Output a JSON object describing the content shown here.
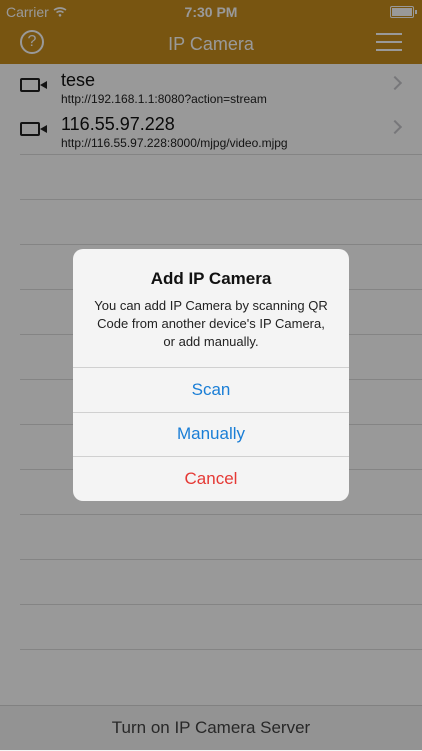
{
  "status_bar": {
    "carrier": "Carrier",
    "time": "7:30 PM"
  },
  "nav": {
    "help_label": "?",
    "title": "IP Camera"
  },
  "cameras": [
    {
      "name": "tese",
      "url": "http://192.168.1.1:8080?action=stream"
    },
    {
      "name": "116.55.97.228",
      "url": "http://116.55.97.228:8000/mjpg/video.mjpg"
    }
  ],
  "alert": {
    "title": "Add IP Camera",
    "message": "You can add IP Camera by scanning QR Code from another device's IP Camera, or add manually.",
    "scan_label": "Scan",
    "manual_label": "Manually",
    "cancel_label": "Cancel"
  },
  "footer": {
    "server_label": "Turn on IP Camera Server"
  },
  "colors": {
    "nav_gold": "#c98e1d",
    "link_blue": "#1a7ed6",
    "cancel_red": "#e53935"
  }
}
